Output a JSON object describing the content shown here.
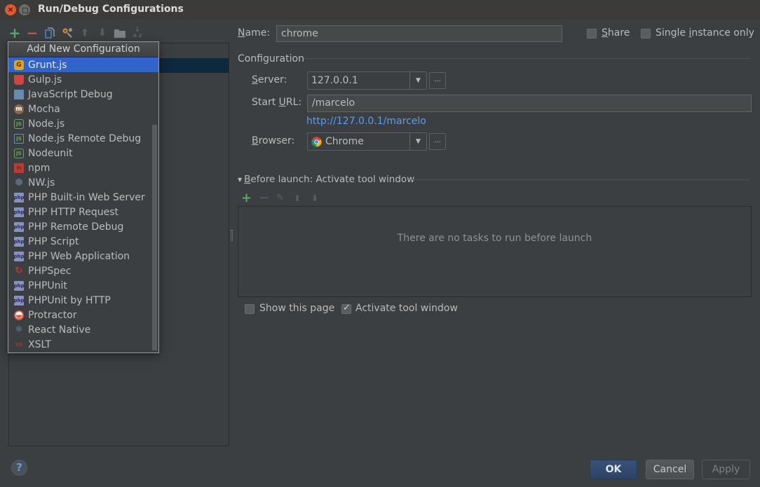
{
  "window": {
    "title": "Run/Debug Configurations"
  },
  "toolbar": {
    "icons": [
      "add-icon",
      "remove-icon",
      "copy-icon",
      "edit-defaults-icon",
      "move-up-icon",
      "move-down-icon",
      "folder-icon",
      "sort-icon"
    ]
  },
  "popup": {
    "header": "Add New Configuration",
    "items": [
      {
        "label": "Grunt.js",
        "icon": "grunt-icon",
        "selected": true
      },
      {
        "label": "Gulp.js",
        "icon": "gulp-icon"
      },
      {
        "label": "JavaScript Debug",
        "icon": "javascript-debug-icon"
      },
      {
        "label": "Mocha",
        "icon": "mocha-icon"
      },
      {
        "label": "Node.js",
        "icon": "nodejs-icon"
      },
      {
        "label": "Node.js Remote Debug",
        "icon": "nodejs-remote-debug-icon"
      },
      {
        "label": "Nodeunit",
        "icon": "nodeunit-icon"
      },
      {
        "label": "npm",
        "icon": "npm-icon"
      },
      {
        "label": "NW.js",
        "icon": "nwjs-icon"
      },
      {
        "label": "PHP Built-in Web Server",
        "icon": "php-builtin-server-icon"
      },
      {
        "label": "PHP HTTP Request",
        "icon": "php-http-request-icon"
      },
      {
        "label": "PHP Remote Debug",
        "icon": "php-remote-debug-icon"
      },
      {
        "label": "PHP Script",
        "icon": "php-script-icon"
      },
      {
        "label": "PHP Web Application",
        "icon": "php-web-application-icon"
      },
      {
        "label": "PHPSpec",
        "icon": "phpspec-icon"
      },
      {
        "label": "PHPUnit",
        "icon": "phpunit-icon"
      },
      {
        "label": "PHPUnit by HTTP",
        "icon": "phpunit-http-icon"
      },
      {
        "label": "Protractor",
        "icon": "protractor-icon"
      },
      {
        "label": "React Native",
        "icon": "react-native-icon"
      },
      {
        "label": "XSLT",
        "icon": "xslt-icon"
      }
    ]
  },
  "form": {
    "name_label_mnemonic": "N",
    "name_label_rest": "ame:",
    "name_value": "chrome",
    "share_label_mnemonic": "S",
    "share_label_rest": "hare",
    "share_checked": false,
    "single_label_pre": "Single ",
    "single_label_mnemonic": "i",
    "single_label_rest": "nstance only",
    "single_checked": false,
    "configuration_title": "Configuration",
    "server_label_mnemonic": "S",
    "server_label_rest": "erver:",
    "server_value": "127.0.0.1",
    "start_url_label_pre": "Start ",
    "start_url_label_mnemonic": "U",
    "start_url_label_rest": "RL:",
    "start_url_value": "/marcelo",
    "resolved_url": "http://127.0.0.1/marcelo",
    "browser_label_mnemonic": "B",
    "browser_label_rest": "rowser:",
    "browser_value": "Chrome",
    "ellipsis": "..."
  },
  "before_launch": {
    "title_mnemonic": "B",
    "title_rest": "efore launch: Activate tool window",
    "empty_text": "There are no tasks to run before launch",
    "show_page_label": "Show this page",
    "show_page_checked": false,
    "activate_label": "Activate tool window",
    "activate_checked": true
  },
  "buttons": {
    "ok": "OK",
    "cancel": "Cancel",
    "apply": "Apply",
    "help": "?"
  },
  "colors": {
    "background": "#3c3f41",
    "selection": "#2f65ca",
    "link": "#589df6",
    "add_green": "#59a869",
    "remove_red": "#c75450"
  }
}
